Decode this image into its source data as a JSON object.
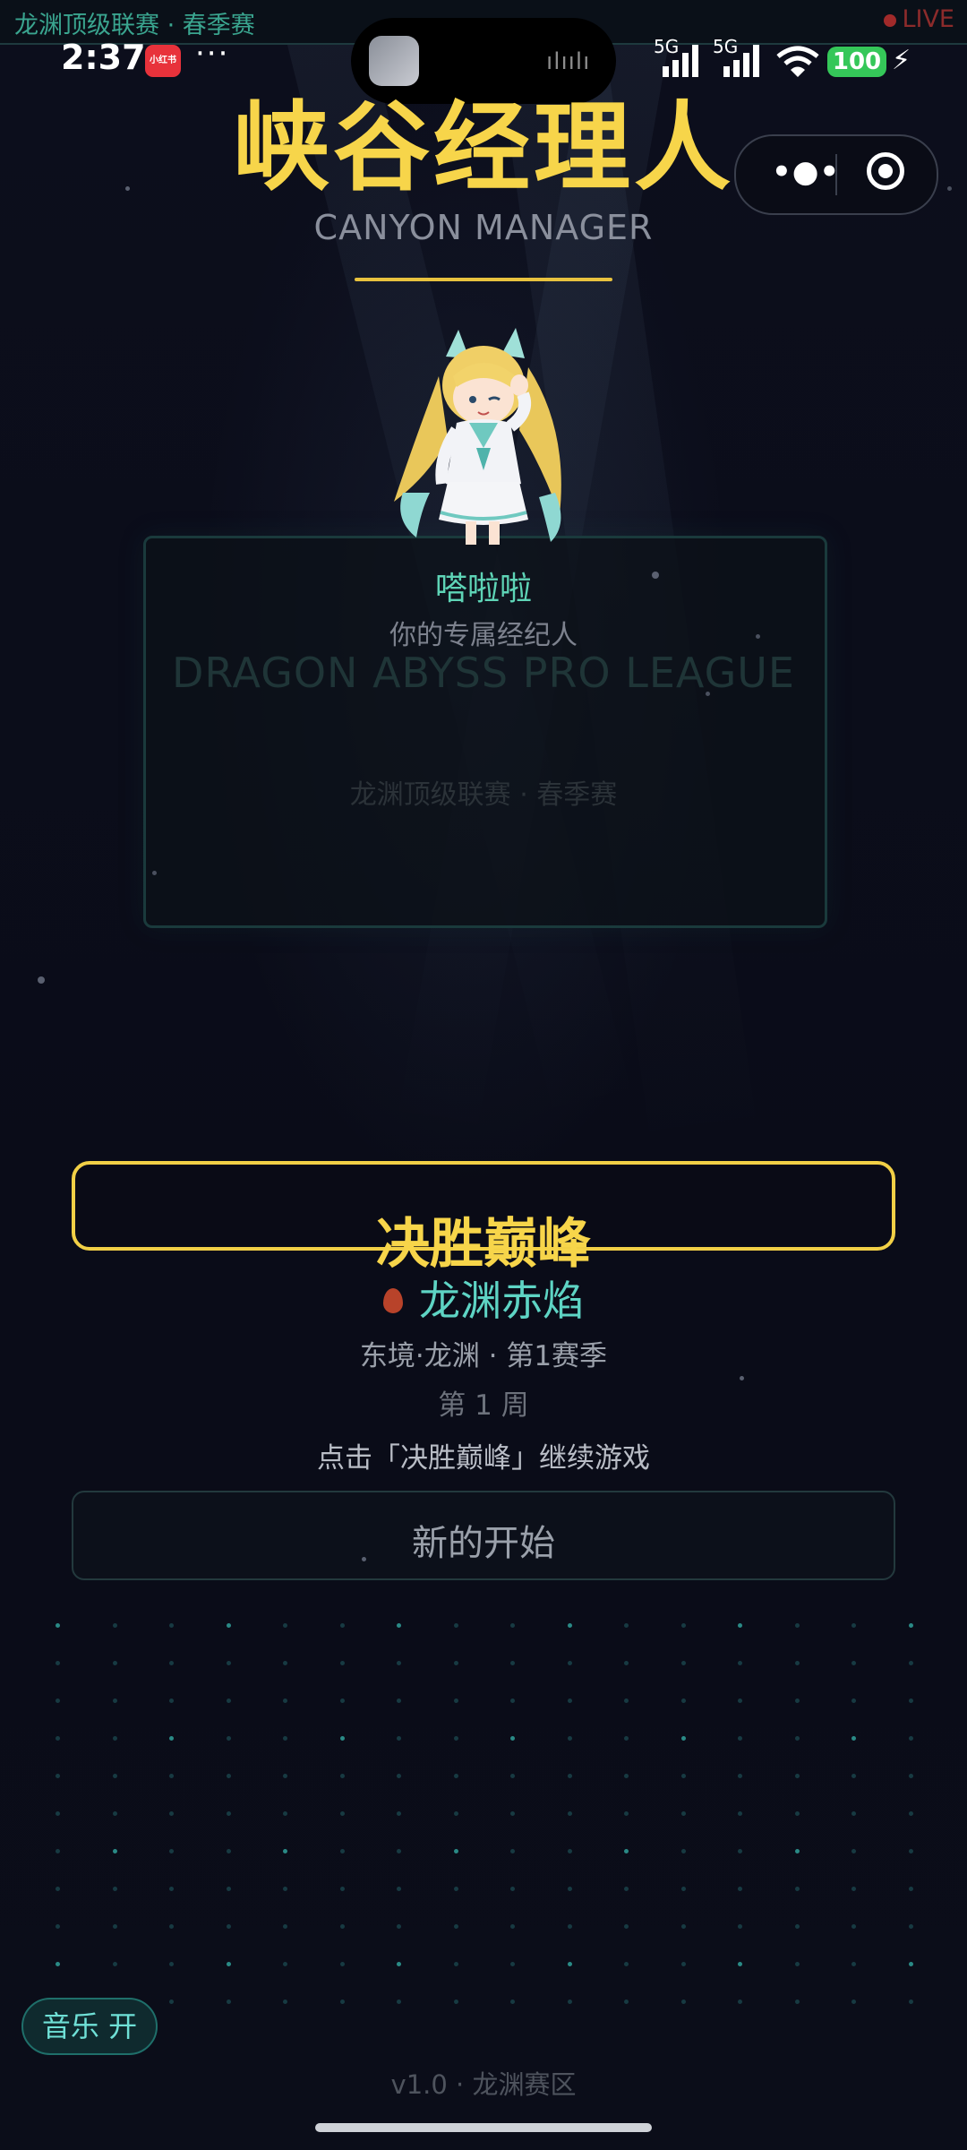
{
  "ticker": {
    "league": "龙渊顶级联赛 · 春季赛",
    "live": "LIVE"
  },
  "status_bar": {
    "time": "2:37",
    "app_badge": "小红书",
    "more": "···",
    "net1": "5G",
    "net2": "5G",
    "battery": "100"
  },
  "header": {
    "title": "峡谷经理人",
    "subtitle": "CANYON MANAGER"
  },
  "agent_panel": {
    "name": "嗒啦啦",
    "role": "你的专属经纪人",
    "league_en": "DRAGON ABYSS PRO LEAGUE",
    "league_cn": "龙渊顶级联赛 · 春季赛"
  },
  "main": {
    "continue_label": "决胜巅峰",
    "team_name": "龙渊赤焰",
    "season_info": "东境·龙渊 · 第1赛季",
    "week_info": "第 1 周",
    "hint": "点击「决胜巅峰」继续游戏",
    "new_game_label": "新的开始"
  },
  "footer": {
    "music_toggle": "音乐 开",
    "version": "v1.0 · 龙渊赛区"
  },
  "colors": {
    "accent_gold": "#f7d54a",
    "accent_teal": "#5ed4c4",
    "background": "#0b0d1a"
  },
  "icons": [
    "more-dots-icon",
    "target-icon",
    "team-flame-icon",
    "battery-icon",
    "signal-icon",
    "wifi-icon"
  ]
}
